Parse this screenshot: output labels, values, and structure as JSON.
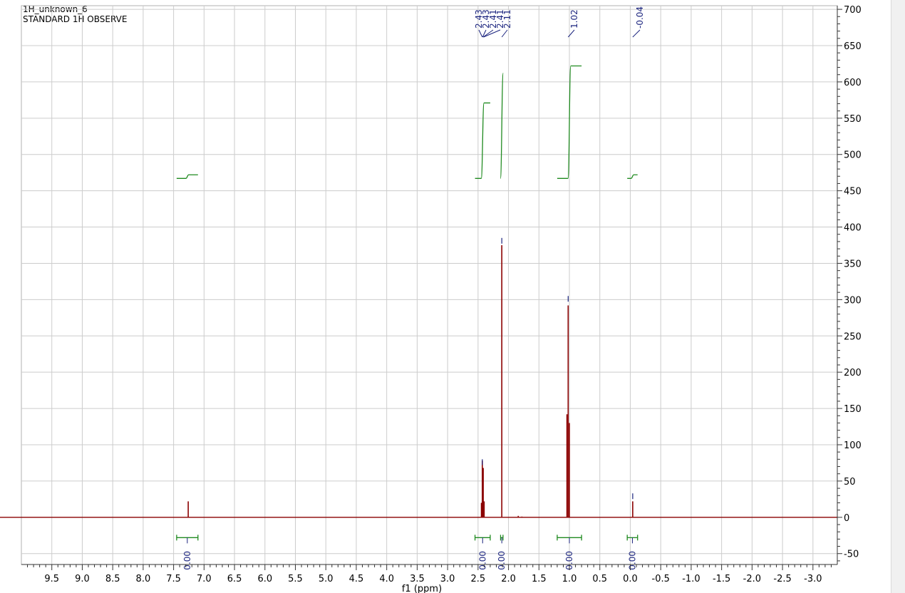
{
  "header": {
    "title": "1H_unknown_6",
    "subtitle": "STANDARD 1H OBSERVE"
  },
  "colors": {
    "spectrum": "#8b0000",
    "integral": "#1f8a1f",
    "peak_label": "#1a237e",
    "grid": "#cccccc",
    "axis": "#333333"
  },
  "chart_data": {
    "type": "line",
    "title": "1H_unknown_6",
    "subtitle": "STANDARD 1H OBSERVE",
    "xlabel": "f1 (ppm)",
    "ylabel": "",
    "x_reversed": true,
    "xlim": [
      10.0,
      -3.4
    ],
    "ylim": [
      -65,
      705
    ],
    "grid": true,
    "x_ticks": [
      "9.5",
      "9.0",
      "8.5",
      "8.0",
      "7.5",
      "7.0",
      "6.5",
      "6.0",
      "5.5",
      "5.0",
      "4.5",
      "4.0",
      "3.5",
      "3.0",
      "2.5",
      "2.0",
      "1.5",
      "1.0",
      "0.5",
      "0.0",
      "-0.5",
      "-1.0",
      "-1.5",
      "-2.0",
      "-2.5",
      "-3.0"
    ],
    "x_tick_values": [
      9.5,
      9.0,
      8.5,
      8.0,
      7.5,
      7.0,
      6.5,
      6.0,
      5.5,
      5.0,
      4.5,
      4.0,
      3.5,
      3.0,
      2.5,
      2.0,
      1.5,
      1.0,
      0.5,
      0.0,
      -0.5,
      -1.0,
      -1.5,
      -2.0,
      -2.5,
      -3.0
    ],
    "y_ticks": [
      "700",
      "650",
      "600",
      "550",
      "500",
      "450",
      "400",
      "350",
      "300",
      "250",
      "200",
      "150",
      "100",
      "50",
      "0",
      "-50"
    ],
    "y_tick_values": [
      700,
      650,
      600,
      550,
      500,
      450,
      400,
      350,
      300,
      250,
      200,
      150,
      100,
      50,
      0,
      -50
    ],
    "peaks": [
      {
        "ppm": 7.26,
        "height": 22
      },
      {
        "ppm": 2.445,
        "height": 20
      },
      {
        "ppm": 2.43,
        "height": 78
      },
      {
        "ppm": 2.415,
        "height": 68
      },
      {
        "ppm": 2.4,
        "height": 22
      },
      {
        "ppm": 2.11,
        "height": 375
      },
      {
        "ppm": 1.84,
        "height": 2
      },
      {
        "ppm": 1.78,
        "height": 1
      },
      {
        "ppm": 1.04,
        "height": 142
      },
      {
        "ppm": 1.02,
        "height": 292
      },
      {
        "ppm": 1.0,
        "height": 130
      },
      {
        "ppm": -0.04,
        "height": 22
      }
    ],
    "peak_labels": {
      "values": [
        "2.43",
        "2.43",
        "2.41",
        "2.41",
        "2.11",
        "1.02",
        "-0.04"
      ],
      "ppm": [
        2.43,
        2.425,
        2.415,
        2.41,
        2.11,
        1.02,
        -0.04
      ]
    },
    "integrals": [
      {
        "from": 7.45,
        "to": 7.1,
        "value": "0.00",
        "y_start": 467,
        "y_end": 472
      },
      {
        "from": 2.55,
        "to": 2.3,
        "value": "0.00",
        "y_start": 467,
        "y_end": 571
      },
      {
        "from": 2.13,
        "to": 2.09,
        "value": "0.00",
        "y_start": 467,
        "y_end": 612
      },
      {
        "from": 1.2,
        "to": 0.8,
        "value": "0.00",
        "y_start": 467,
        "y_end": 622
      },
      {
        "from": 0.05,
        "to": -0.12,
        "value": "0.00",
        "y_start": 467,
        "y_end": 472
      }
    ]
  }
}
